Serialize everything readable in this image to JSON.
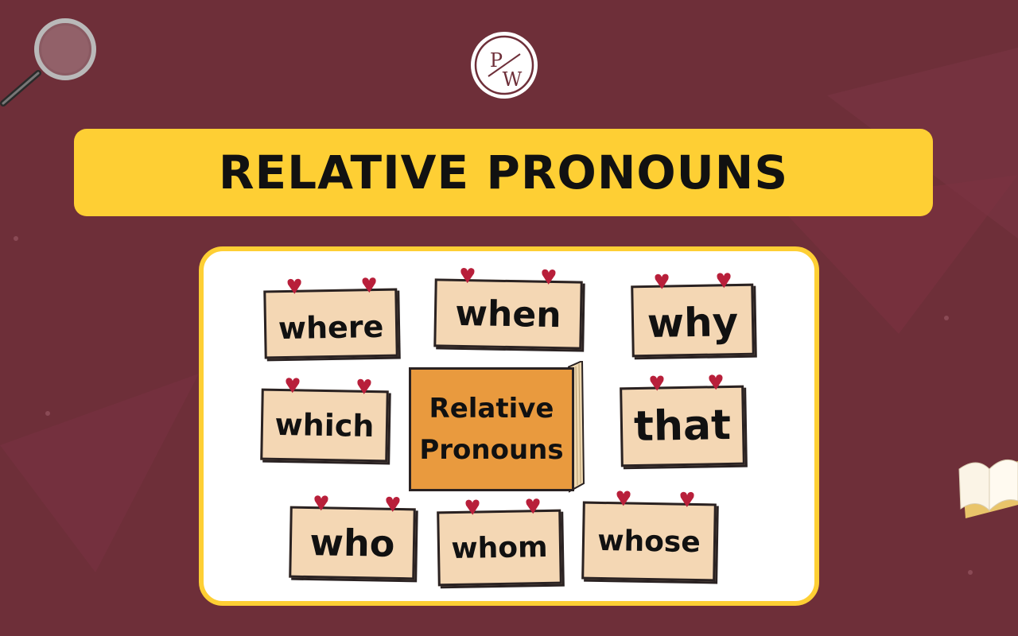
{
  "logo": {
    "letters_top": "P",
    "letters_bottom": "W",
    "icon": "pw-logo-icon"
  },
  "title": "RELATIVE PRONOUNS",
  "center_book": {
    "line1": "Relative",
    "line2": "Pronouns"
  },
  "cards": {
    "where": "where",
    "when": "when",
    "why": "why",
    "which": "which",
    "that": "that",
    "who": "who",
    "whom": "whom",
    "whose": "whose"
  },
  "colors": {
    "background": "#6e2f39",
    "title_bar": "#fecf34",
    "card_fill": "#f4d7b4",
    "book_fill": "#e99a3e",
    "pin": "#b81f3a"
  }
}
